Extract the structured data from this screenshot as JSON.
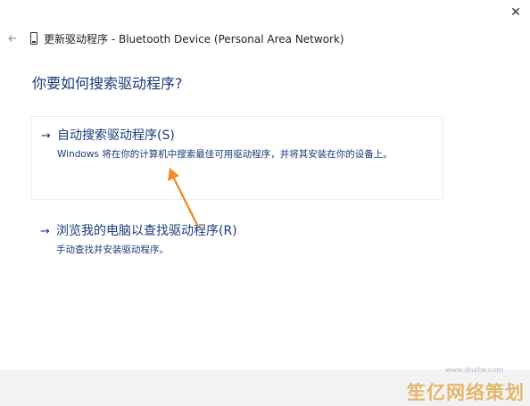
{
  "window": {
    "title": "更新驱动程序 - Bluetooth Device (Personal Area Network)",
    "back_icon": "arrow-left-icon",
    "device_icon": "device-icon",
    "close_glyph": "✕"
  },
  "main": {
    "heading": "你要如何搜索驱动程序?",
    "options": [
      {
        "arrow": "→",
        "title": "自动搜索驱动程序(S)",
        "description": "Windows 将在你的计算机中搜索最佳可用驱动程序，并将其安装在你的设备上。"
      },
      {
        "arrow": "→",
        "title": "浏览我的电脑以查找驱动程序(R)",
        "description": "手动查找并安装驱动程序。"
      }
    ]
  },
  "annotation": {
    "color": "#f08c2a",
    "icon": "annotation-arrow-icon"
  },
  "watermark": {
    "text": "笙亿网络策划",
    "url": "www.dnxtw.com",
    "color": "#e3b56b"
  }
}
